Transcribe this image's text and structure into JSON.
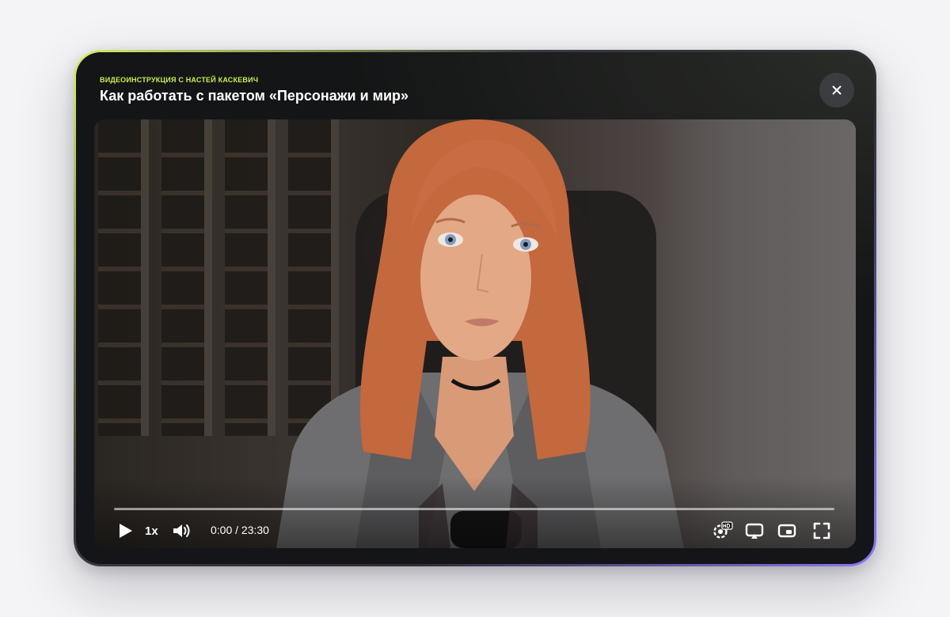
{
  "header": {
    "kicker": "ВИДЕОИНСТРУКЦИЯ С НАСТЕЙ КАСКЕВИЧ",
    "title": "Как работать с пакетом «Персонажи и мир»",
    "close_icon": "close-icon"
  },
  "player": {
    "progress": 0,
    "speed_label": "1x",
    "time_current": "0:00",
    "time_separator": " / ",
    "time_total": "23:30",
    "icons": {
      "play": "play-icon",
      "volume": "volume-icon",
      "quality": "hd-settings-icon",
      "cast": "cast-icon",
      "pip": "picture-in-picture-icon",
      "fullscreen": "fullscreen-icon"
    }
  },
  "colors": {
    "accent_kicker": "#c9ef4b",
    "gradient_end": "#8a78f5",
    "modal_bg": "#141516"
  }
}
